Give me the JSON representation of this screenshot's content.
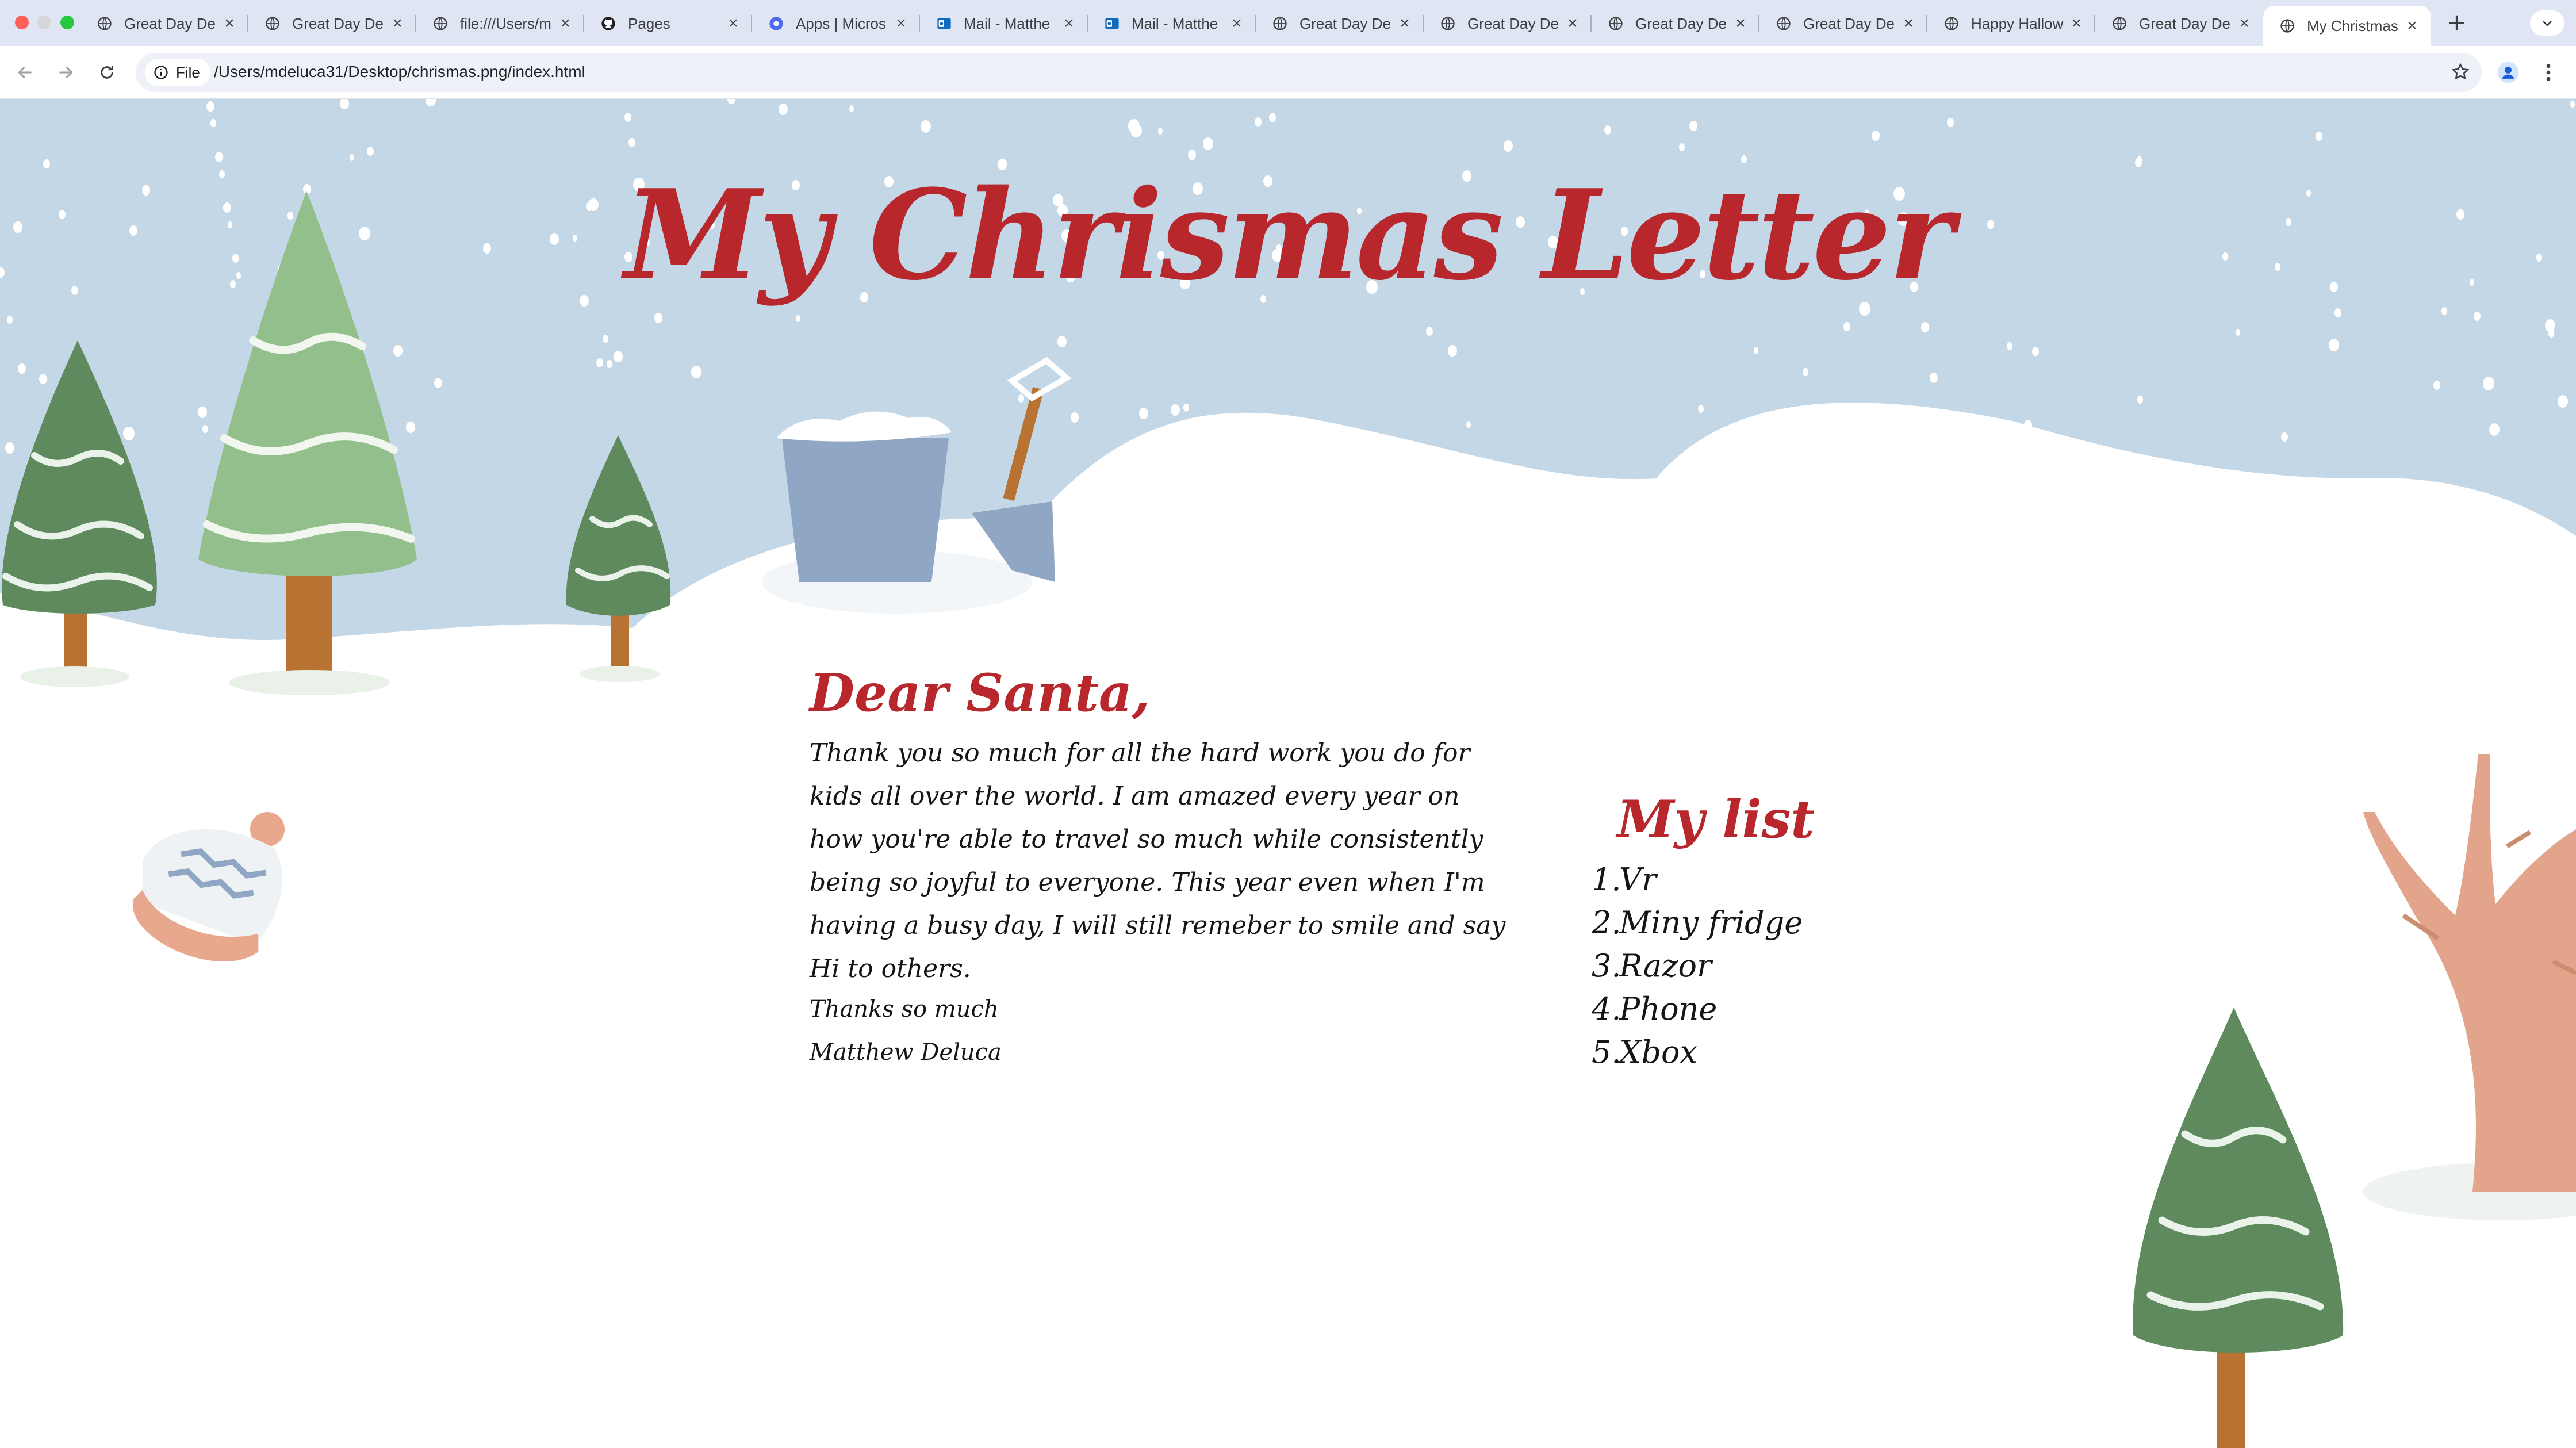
{
  "browser": {
    "tabs": [
      {
        "label": "Great Day De",
        "icon": "globe-icon"
      },
      {
        "label": "Great Day De",
        "icon": "globe-icon"
      },
      {
        "label": "file:///Users/m",
        "icon": "globe-icon"
      },
      {
        "label": "Pages",
        "icon": "github-icon"
      },
      {
        "label": "Apps | Micros",
        "icon": "microsoft-apps-icon"
      },
      {
        "label": "Mail - Matthe",
        "icon": "outlook-icon"
      },
      {
        "label": "Mail - Matthe",
        "icon": "outlook-icon"
      },
      {
        "label": "Great Day De",
        "icon": "globe-icon"
      },
      {
        "label": "Great Day De",
        "icon": "globe-icon"
      },
      {
        "label": "Great Day De",
        "icon": "globe-icon"
      },
      {
        "label": "Great Day De",
        "icon": "globe-icon"
      },
      {
        "label": "Happy Hallow",
        "icon": "globe-icon"
      },
      {
        "label": "Great Day De",
        "icon": "globe-icon"
      },
      {
        "label": "My Christmas",
        "icon": "globe-icon",
        "active": true
      }
    ],
    "scheme_chip": "File",
    "url": "/Users/mdeluca31/Desktop/chrismas.png/index.html"
  },
  "page": {
    "title": "My Chrismas Letter",
    "greeting": "Dear Santa,",
    "body": "Thank you so much for all the hard work you do for kids all over the world. I am amazed every year on how you're able to travel so much while consistently being so joyful to everyone. This year even when I'm having a busy day, I will still remeber to smile and say Hi to others.",
    "closing": "Thanks so much",
    "signature": "Matthew Deluca",
    "list_title": "My list",
    "list": [
      "Vr",
      "Miny fridge",
      "Razor",
      "Phone",
      "Xbox"
    ]
  },
  "colors": {
    "title_red": "#b8272b",
    "sky": "#c3d7e6",
    "snow": "#ffffff",
    "tree_dark": "#5e8a5e",
    "tree_light": "#93bf8c",
    "trunk": "#b87333",
    "bucket": "#8fa7c4"
  }
}
